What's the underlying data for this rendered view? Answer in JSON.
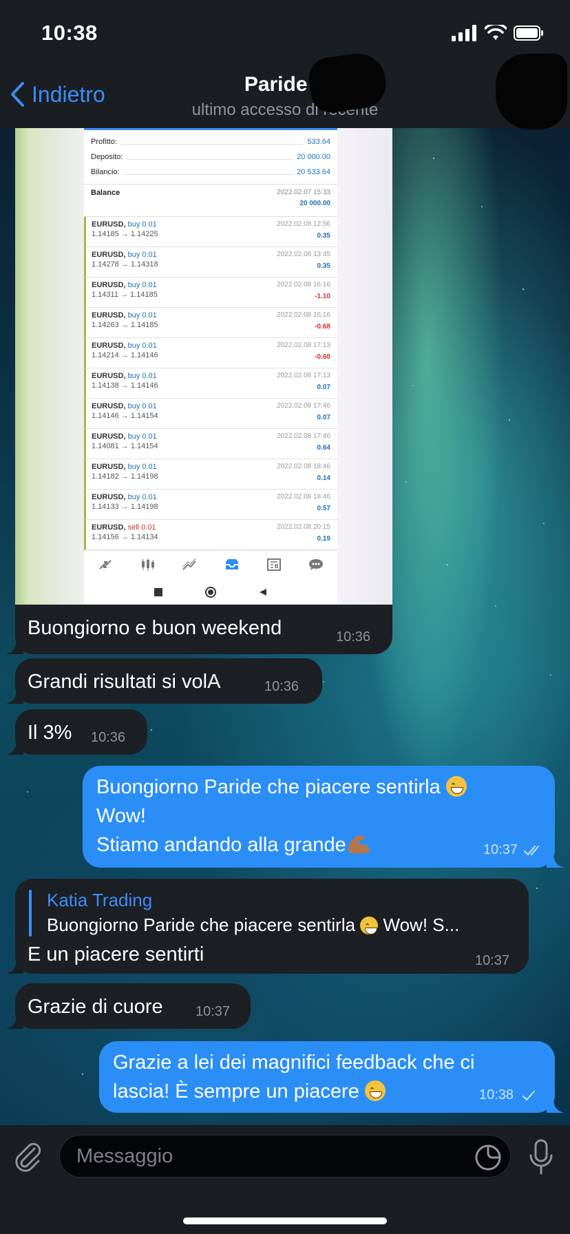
{
  "status": {
    "time": "10:38"
  },
  "header": {
    "back_label": "Indietro",
    "title": "Paride T",
    "subtitle": "ultimo accesso di recente"
  },
  "photo": {
    "summary": [
      {
        "label": "Profitto:",
        "value": "533.64"
      },
      {
        "label": "Deposito:",
        "value": "20 000.00"
      },
      {
        "label": "Bilancio:",
        "value": "20 533.64"
      }
    ],
    "balance": {
      "label": "Balance",
      "date": "2022.02.07 15:33",
      "amount": "20 000.00"
    },
    "trades": [
      {
        "symbol": "EURUSD,",
        "side": "buy 0.01",
        "prices": "1.14185 → 1.14225",
        "date": "2022.02.08 12:56",
        "profit": "0.35"
      },
      {
        "symbol": "EURUSD,",
        "side": "buy 0.01",
        "prices": "1.14278 → 1.14318",
        "date": "2022.02.08 13:45",
        "profit": "0.35"
      },
      {
        "symbol": "EURUSD,",
        "side": "buy 0.01",
        "prices": "1.14311 → 1.14185",
        "date": "2022.02.08 16:16",
        "profit": "-1.10"
      },
      {
        "symbol": "EURUSD,",
        "side": "buy 0.01",
        "prices": "1.14263 → 1.14185",
        "date": "2022.02.08 16:16",
        "profit": "-0.68"
      },
      {
        "symbol": "EURUSD,",
        "side": "buy 0.01",
        "prices": "1.14214 → 1.14146",
        "date": "2022.02.08 17:13",
        "profit": "-0.60"
      },
      {
        "symbol": "EURUSD,",
        "side": "buy 0.01",
        "prices": "1.14138 → 1.14146",
        "date": "2022.02.08 17:13",
        "profit": "0.07"
      },
      {
        "symbol": "EURUSD,",
        "side": "buy 0.01",
        "prices": "1.14146 → 1.14154",
        "date": "2022.02.08 17:46",
        "profit": "0.07"
      },
      {
        "symbol": "EURUSD,",
        "side": "buy 0.01",
        "prices": "1.14081 → 1.14154",
        "date": "2022.02.08 17:46",
        "profit": "0.64"
      },
      {
        "symbol": "EURUSD,",
        "side": "buy 0.01",
        "prices": "1.14182 → 1.14198",
        "date": "2022.02.08 18:46",
        "profit": "0.14"
      },
      {
        "symbol": "EURUSD,",
        "side": "buy 0.01",
        "prices": "1.14133 → 1.14198",
        "date": "2022.02.08 18:46",
        "profit": "0.57"
      },
      {
        "symbol": "EURUSD,",
        "side": "sell 0.01",
        "prices": "1.14156 → 1.14134",
        "date": "2022.02.08 20:15",
        "profit": "0.19"
      }
    ]
  },
  "messages": {
    "m1": {
      "text": "Buongiorno e buon weekend",
      "time": "10:36"
    },
    "m2": {
      "text": "Grandi risultati si volA",
      "time": "10:36"
    },
    "m3": {
      "text": "Il 3%",
      "time": "10:36"
    },
    "m4": {
      "line1": "Buongiorno Paride che piacere sentirla",
      "line2": "Wow!",
      "line3": "Stiamo andando alla grande",
      "time": "10:37"
    },
    "m5": {
      "reply_name": "Katia Trading",
      "reply_text": "Buongiorno Paride che piacere sentirla",
      "reply_tail": "Wow!  S...",
      "text": "E un piacere sentirti",
      "time": "10:37"
    },
    "m6": {
      "text": "Grazie di cuore",
      "time": "10:37"
    },
    "m7": {
      "line1": "Grazie a lei dei magnifici feedback che ci",
      "line2": "lascia! È sempre un piacere",
      "time": "10:38"
    }
  },
  "input": {
    "placeholder": "Messaggio"
  },
  "colors": {
    "accent": "#2b8ef7",
    "incoming_bubble": "#1c1f24",
    "bar": "#1a1d22"
  }
}
